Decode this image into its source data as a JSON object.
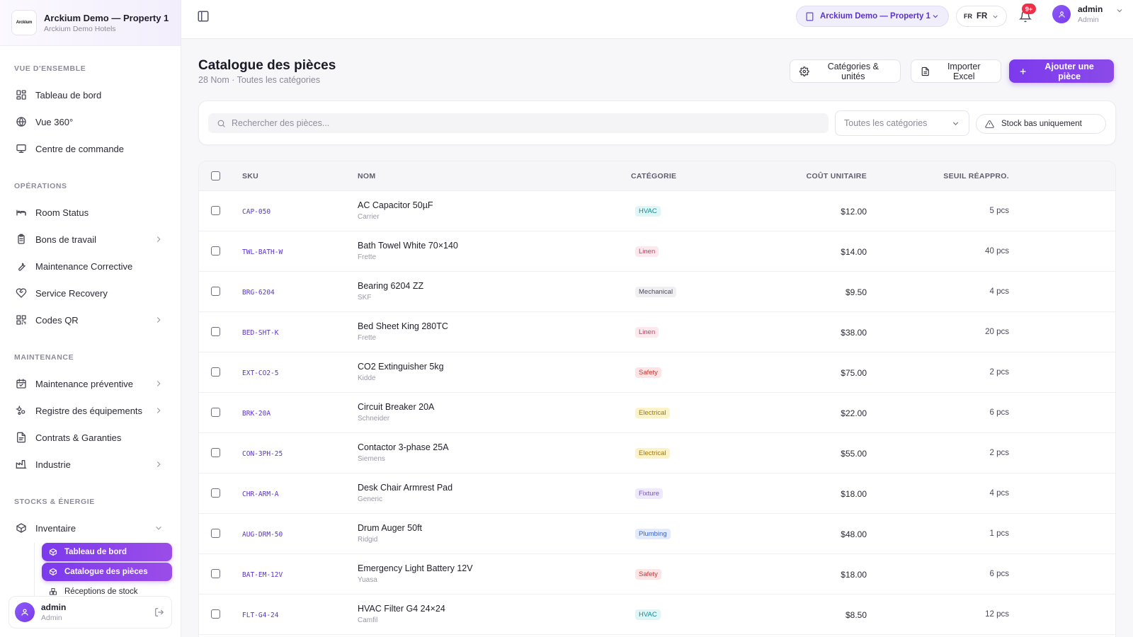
{
  "brand": {
    "logo_text": "Arckium",
    "title": "Arckium Demo — Property 1",
    "subtitle": "Arckium Demo Hotels"
  },
  "sidebar": {
    "sections": [
      {
        "title": "VUE D'ENSEMBLE",
        "items": [
          {
            "label": "Tableau de bord",
            "icon": "dashboard-icon"
          },
          {
            "label": "Vue 360°",
            "icon": "globe-icon"
          },
          {
            "label": "Centre de commande",
            "icon": "monitor-icon"
          }
        ]
      },
      {
        "title": "OPÉRATIONS",
        "items": [
          {
            "label": "Room Status",
            "icon": "bed-icon"
          },
          {
            "label": "Bons de travail",
            "icon": "clipboard-icon",
            "chevron": true
          },
          {
            "label": "Maintenance Corrective",
            "icon": "wrench-icon"
          },
          {
            "label": "Service Recovery",
            "icon": "heart-handshake-icon"
          },
          {
            "label": "Codes QR",
            "icon": "qr-code-icon",
            "chevron": true
          }
        ]
      },
      {
        "title": "MAINTENANCE",
        "items": [
          {
            "label": "Maintenance préventive",
            "icon": "calendar-check-icon",
            "chevron": true
          },
          {
            "label": "Registre des équipements",
            "icon": "cogs-icon",
            "chevron": true
          },
          {
            "label": "Contrats & Garanties",
            "icon": "document-icon"
          },
          {
            "label": "Industrie",
            "icon": "factory-icon",
            "chevron": true
          }
        ]
      },
      {
        "title": "STOCKS & ÉNERGIE",
        "items": [
          {
            "label": "Inventaire",
            "icon": "box-icon",
            "chevron_down": true
          }
        ]
      }
    ],
    "inventory_sub": [
      {
        "label": "Tableau de bord",
        "active": true
      },
      {
        "label": "Catalogue des pièces",
        "active": true
      },
      {
        "label": "Réceptions de stock",
        "active": false
      }
    ],
    "user": {
      "name": "admin",
      "role": "Admin"
    }
  },
  "topbar": {
    "property": "Arckium Demo — Property 1",
    "lang_flag": "FR",
    "lang": "FR",
    "notif_badge": "9+",
    "user": {
      "name": "admin",
      "role": "Admin"
    }
  },
  "page": {
    "title": "Catalogue des pièces",
    "subtitle": "28 Nom · Toutes les catégories",
    "buttons": {
      "categories": "Catégories & unités",
      "import": "Importer Excel",
      "add": "Ajouter une pièce"
    }
  },
  "filters": {
    "search_placeholder": "Rechercher des pièces...",
    "category_select": "Toutes les catégories",
    "low_stock": "Stock bas uniquement"
  },
  "table": {
    "headers": {
      "sku": "SKU",
      "name": "NOM",
      "category": "CATÉGORIE",
      "cost": "COÛT UNITAIRE",
      "reorder": "SEUIL RÉAPPRO."
    },
    "rows": [
      {
        "sku": "CAP-050",
        "name": "AC Capacitor 50µF",
        "brand": "Carrier",
        "category": "HVAC",
        "cost": "$12.00",
        "reorder": "5 pcs"
      },
      {
        "sku": "TWL-BATH-W",
        "name": "Bath Towel White 70×140",
        "brand": "Frette",
        "category": "Linen",
        "cost": "$14.00",
        "reorder": "40 pcs"
      },
      {
        "sku": "BRG-6204",
        "name": "Bearing 6204 ZZ",
        "brand": "SKF",
        "category": "Mechanical",
        "cost": "$9.50",
        "reorder": "4 pcs"
      },
      {
        "sku": "BED-SHT-K",
        "name": "Bed Sheet King 280TC",
        "brand": "Frette",
        "category": "Linen",
        "cost": "$38.00",
        "reorder": "20 pcs"
      },
      {
        "sku": "EXT-CO2-5",
        "name": "CO2 Extinguisher 5kg",
        "brand": "Kidde",
        "category": "Safety",
        "cost": "$75.00",
        "reorder": "2 pcs"
      },
      {
        "sku": "BRK-20A",
        "name": "Circuit Breaker 20A",
        "brand": "Schneider",
        "category": "Electrical",
        "cost": "$22.00",
        "reorder": "6 pcs"
      },
      {
        "sku": "CON-3PH-25",
        "name": "Contactor 3-phase 25A",
        "brand": "Siemens",
        "category": "Electrical",
        "cost": "$55.00",
        "reorder": "2 pcs"
      },
      {
        "sku": "CHR-ARM-A",
        "name": "Desk Chair Armrest Pad",
        "brand": "Generic",
        "category": "Fixture",
        "cost": "$18.00",
        "reorder": "4 pcs"
      },
      {
        "sku": "AUG-DRM-50",
        "name": "Drum Auger 50ft",
        "brand": "Ridgid",
        "category": "Plumbing",
        "cost": "$48.00",
        "reorder": "1 pcs"
      },
      {
        "sku": "BAT-EM-12V",
        "name": "Emergency Light Battery 12V",
        "brand": "Yuasa",
        "category": "Safety",
        "cost": "$18.00",
        "reorder": "6 pcs"
      },
      {
        "sku": "FLT-G4-24",
        "name": "HVAC Filter G4 24×24",
        "brand": "Camfil",
        "category": "HVAC",
        "cost": "$8.50",
        "reorder": "12 pcs"
      }
    ]
  },
  "colors": {
    "accent": "#7c3aed",
    "HVAC": {
      "bg": "#dff6f7",
      "fg": "#0e8a93"
    },
    "Linen": {
      "bg": "#fde8ee",
      "fg": "#c43a64"
    },
    "Mechanical": {
      "bg": "#f0f0f3",
      "fg": "#4a4a58"
    },
    "Safety": {
      "bg": "#fde5e5",
      "fg": "#cc3333"
    },
    "Electrical": {
      "bg": "#fdf3c8",
      "fg": "#a3770a"
    },
    "Fixture": {
      "bg": "#efe9fd",
      "fg": "#7b4bd6"
    },
    "Plumbing": {
      "bg": "#e3ecfd",
      "fg": "#3b62c9"
    }
  }
}
